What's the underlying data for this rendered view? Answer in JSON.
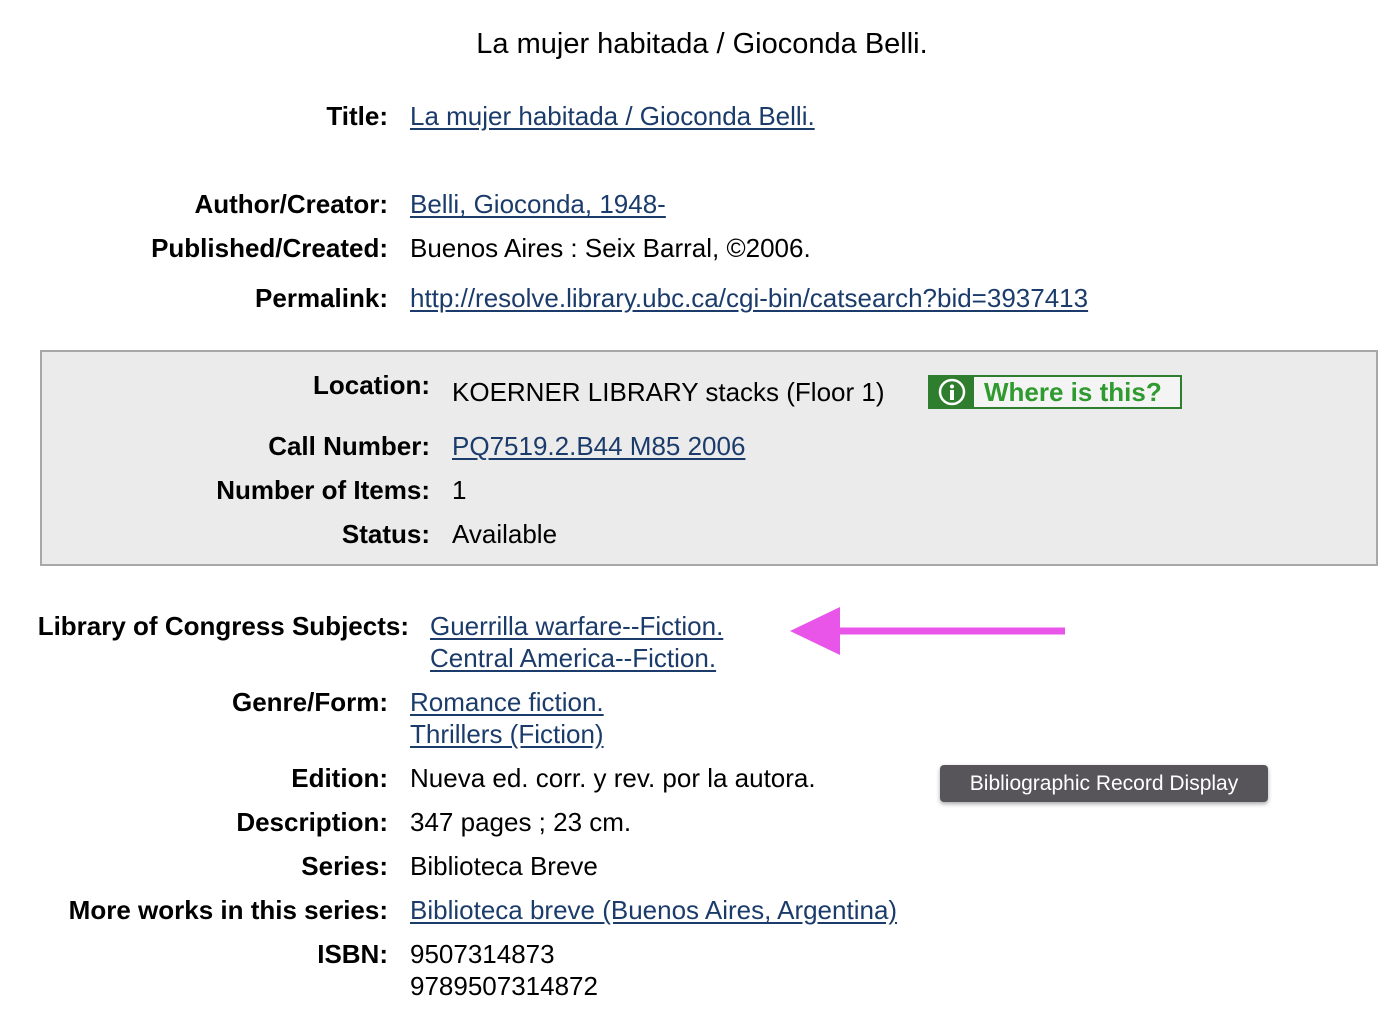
{
  "page_title": "La mujer habitada / Gioconda Belli.",
  "record": {
    "title_label": "Title:",
    "title_value": "La mujer habitada / Gioconda Belli.",
    "author_label": "Author/Creator:",
    "author_value": "Belli, Gioconda, 1948-",
    "published_label": "Published/Created:",
    "published_value": "Buenos Aires : Seix Barral, ©2006.",
    "permalink_label": "Permalink:",
    "permalink_value": "http://resolve.library.ubc.ca/cgi-bin/catsearch?bid=3937413"
  },
  "holdings": {
    "location_label": "Location:",
    "location_value": "KOERNER LIBRARY stacks (Floor 1)",
    "where_button": "Where is this?",
    "call_number_label": "Call Number:",
    "call_number_value": "PQ7519.2.B44 M85 2006",
    "items_label": "Number of Items:",
    "items_value": "1",
    "status_label": "Status:",
    "status_value": "Available"
  },
  "details": {
    "subjects_label": "Library of Congress Subjects:",
    "subjects": [
      "Guerrilla warfare--Fiction.",
      "Central America--Fiction."
    ],
    "genre_label": "Genre/Form:",
    "genres": [
      "Romance fiction.",
      "Thrillers (Fiction)"
    ],
    "edition_label": "Edition:",
    "edition_value": "Nueva ed. corr. y rev. por la autora.",
    "description_label": "Description:",
    "description_value": "347 pages ; 23 cm.",
    "series_label": "Series:",
    "series_value": "Biblioteca Breve",
    "more_works_label": "More works in this series:",
    "more_works_value": "Biblioteca breve (Buenos Aires, Argentina)",
    "isbn_label": "ISBN:",
    "isbns": [
      "9507314873",
      "9789507314872"
    ]
  },
  "tooltip": "Bibliographic Record Display",
  "colors": {
    "link": "#1b3c6b",
    "where_green": "#2f9a2f",
    "arrow": "#e855e8",
    "box_bg": "#ebebeb"
  },
  "icons": {
    "info": "info-icon",
    "arrow": "left-arrow-annotation"
  }
}
